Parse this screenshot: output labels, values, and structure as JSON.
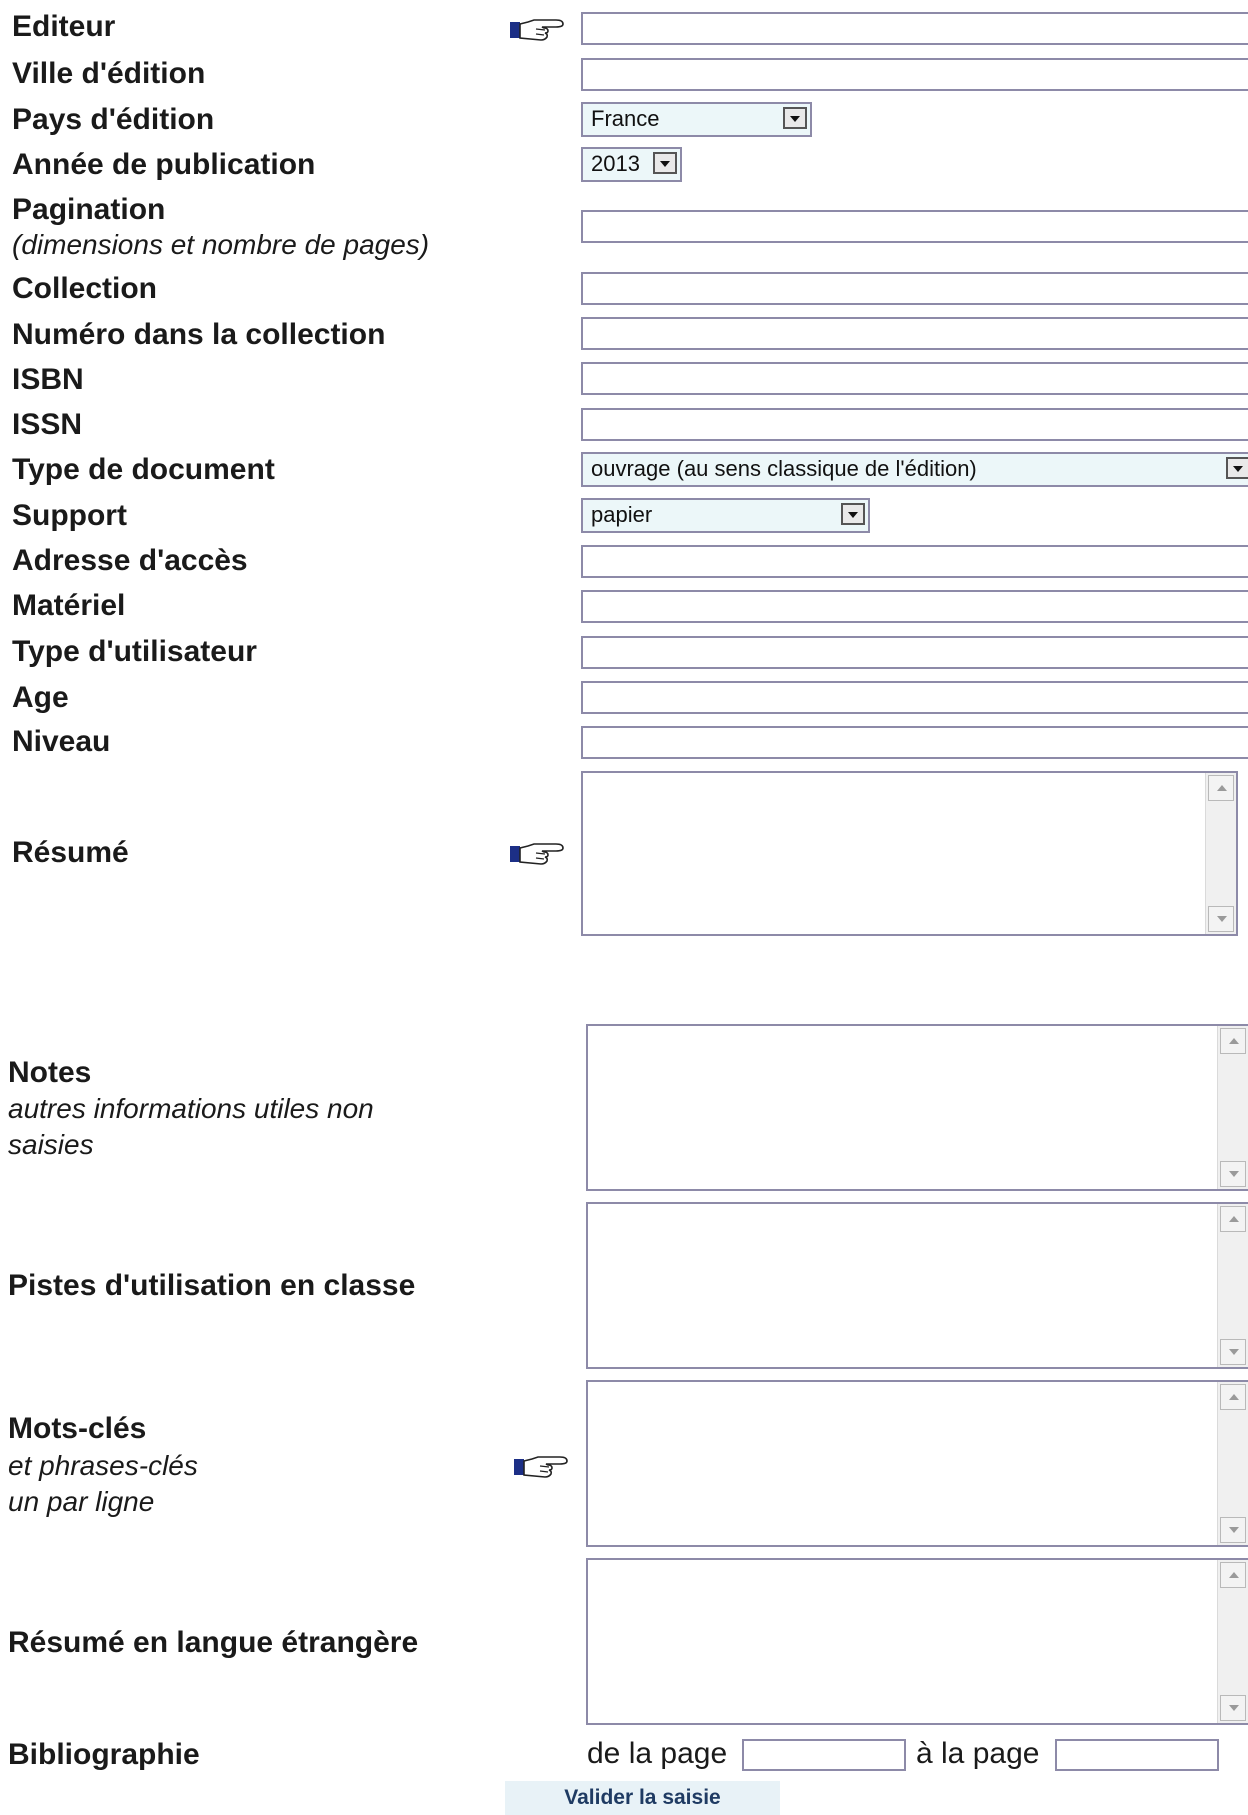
{
  "fields": {
    "editeur": {
      "label": "Editeur",
      "value": ""
    },
    "ville": {
      "label": "Ville d'édition",
      "value": ""
    },
    "pays": {
      "label": "Pays d'édition",
      "selected": "France"
    },
    "annee": {
      "label": "Année de publication",
      "selected": "2013"
    },
    "pagination": {
      "label": "Pagination",
      "sublabel": "(dimensions et nombre de pages)",
      "value": ""
    },
    "collection": {
      "label": "Collection",
      "value": ""
    },
    "numero": {
      "label": "Numéro dans la collection",
      "value": ""
    },
    "isbn": {
      "label": "ISBN",
      "value": ""
    },
    "issn": {
      "label": "ISSN",
      "value": ""
    },
    "type_document": {
      "label": "Type de document",
      "selected": "ouvrage (au sens classique de l'édition)"
    },
    "support": {
      "label": "Support",
      "selected": "papier"
    },
    "adresse": {
      "label": "Adresse d'accès",
      "value": ""
    },
    "materiel": {
      "label": "Matériel",
      "value": ""
    },
    "type_utilisateur": {
      "label": "Type d'utilisateur",
      "value": ""
    },
    "age": {
      "label": "Age",
      "value": ""
    },
    "niveau": {
      "label": "Niveau",
      "value": ""
    },
    "resume": {
      "label": "Résumé",
      "value": ""
    },
    "notes": {
      "label": "Notes",
      "sublabel_1": "autres informations utiles non",
      "sublabel_2": "saisies",
      "value": ""
    },
    "pistes": {
      "label": "Pistes d'utilisation en classe",
      "value": ""
    },
    "mots_cles": {
      "label": "Mots-clés",
      "sublabel_1": "et phrases-clés",
      "sublabel_2": "un par ligne",
      "value": ""
    },
    "resume_etranger": {
      "label": "Résumé en langue étrangère",
      "value": ""
    },
    "bibliographie": {
      "label": "Bibliographie",
      "from_text": "de la page",
      "to_text": "à la page",
      "from_value": "",
      "to_value": ""
    }
  },
  "icons": {
    "help": "pointing-hand-icon"
  },
  "actions": {
    "validate_label": "Valider la saisie"
  },
  "colors": {
    "field_border": "#8d8aa8",
    "select_background": "#ecf7f9",
    "button_text": "#1f3b63",
    "button_background": "#e8f2f7"
  }
}
